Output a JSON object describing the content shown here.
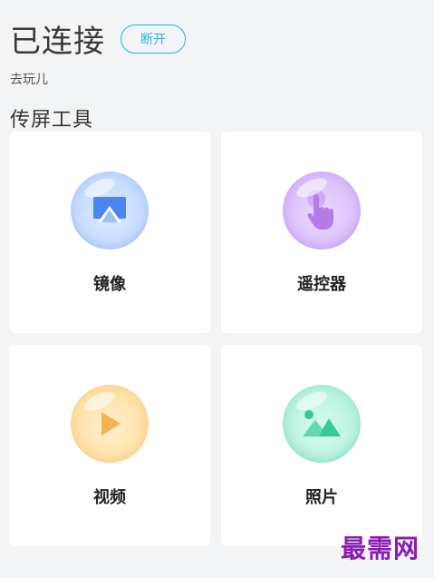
{
  "header": {
    "title": "已连接",
    "disconnect_label": "断开",
    "subtitle": "去玩儿"
  },
  "section": {
    "title": "传屏工具"
  },
  "tools": [
    {
      "label": "镜像",
      "icon": "mirror-icon",
      "color": "#4a86f0"
    },
    {
      "label": "遥控器",
      "icon": "hand-pointer-icon",
      "color": "#b47be8"
    },
    {
      "label": "视频",
      "icon": "play-icon",
      "color": "#f5b24e"
    },
    {
      "label": "照片",
      "icon": "image-icon",
      "color": "#37c995"
    }
  ],
  "watermark": "最需网"
}
